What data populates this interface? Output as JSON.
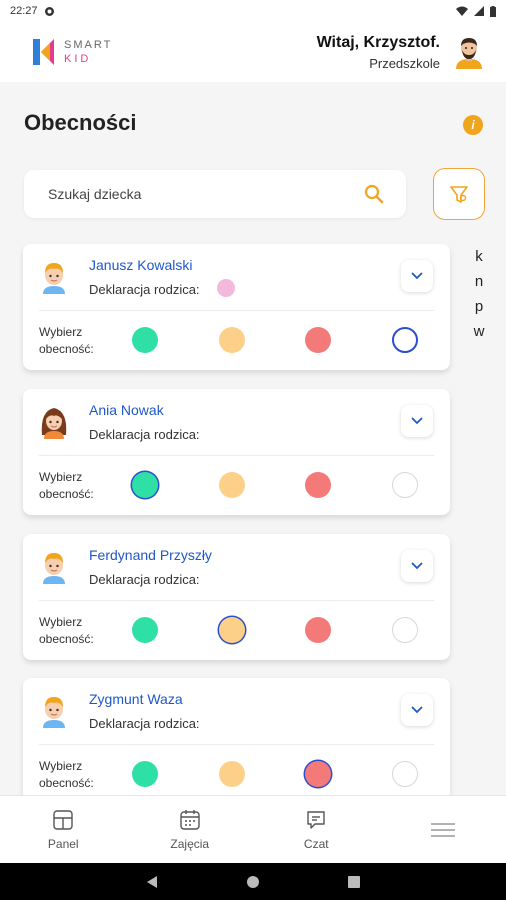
{
  "status_bar": {
    "time": "22:27"
  },
  "header": {
    "logo_smart": "SMART",
    "logo_kid": "KID",
    "greeting": "Witaj, Krzysztof.",
    "group": "Przedszkole"
  },
  "page": {
    "title": "Obecności"
  },
  "search": {
    "placeholder": "Szukaj dziecka"
  },
  "alpha_index": [
    "k",
    "n",
    "p",
    "w"
  ],
  "labels": {
    "declaration": "Deklaracja rodzica:",
    "choose_line1": "Wybierz",
    "choose_line2": "obecność:"
  },
  "attendance_colors": {
    "present": "#2ee0a6",
    "late": "#fdd08a",
    "absent": "#f47a7a",
    "none": "#ffffff",
    "selected_ring": "#2b4ed0",
    "declaration": "#f4b8dc"
  },
  "children": [
    {
      "name": "Janusz Kowalski",
      "avatar": "boy-icon",
      "declaration_set": true,
      "selected": "none"
    },
    {
      "name": "Ania Nowak",
      "avatar": "girl-icon",
      "declaration_set": false,
      "selected": "present"
    },
    {
      "name": "Ferdynand Przyszły",
      "avatar": "boy-icon",
      "declaration_set": false,
      "selected": "late"
    },
    {
      "name": "Zygmunt Waza",
      "avatar": "boy-icon",
      "declaration_set": false,
      "selected": "absent"
    }
  ],
  "nav": [
    {
      "label": "Panel",
      "icon": "panel-icon"
    },
    {
      "label": "Zajęcia",
      "icon": "calendar-icon"
    },
    {
      "label": "Czat",
      "icon": "chat-icon"
    },
    {
      "label": "",
      "icon": "menu-icon"
    }
  ]
}
